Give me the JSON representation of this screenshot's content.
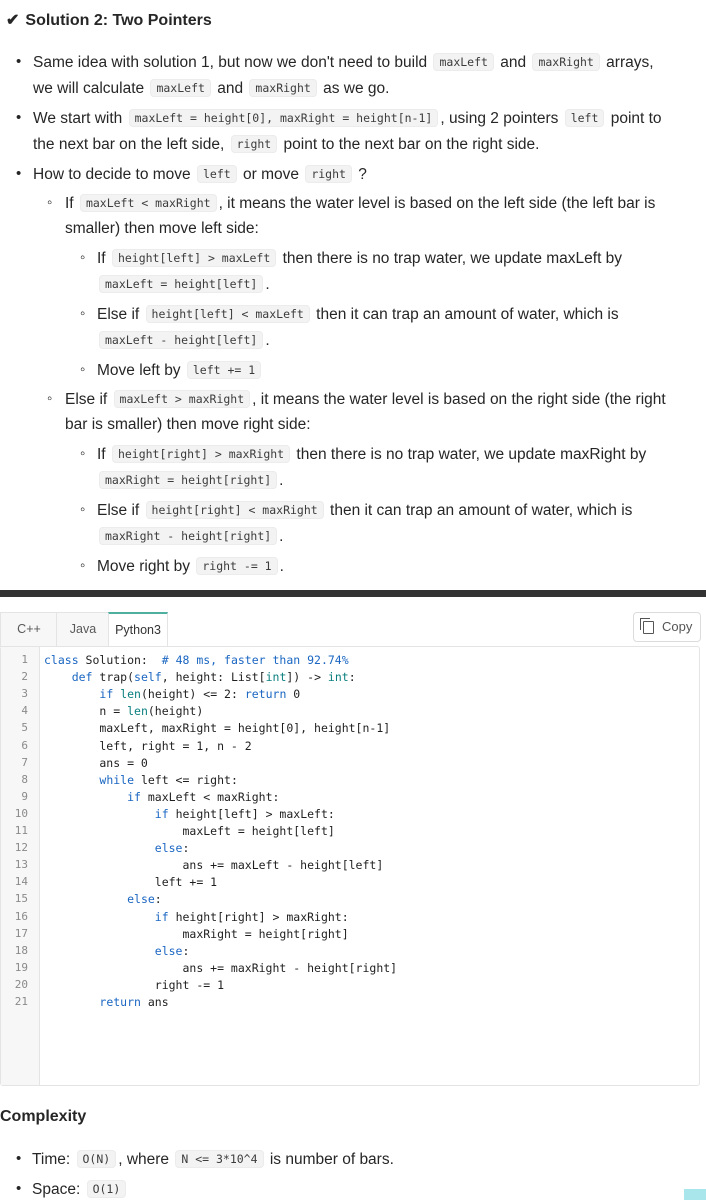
{
  "title": "Solution 2: Two Pointers",
  "content": {
    "b1_l1a": "Same idea with solution 1, but now we don't need to build",
    "b1_code1": "maxLeft",
    "b1_and": "and",
    "b1_code2": "maxRight",
    "b1_arrays": "arrays,",
    "b1_l2a": "we will calculate",
    "b1_code3": "maxLeft",
    "b1_and2": "and",
    "b1_code4": "maxRight",
    "b1_l2b": "as we go.",
    "b2_l1a": "We start with",
    "b2_code1": "maxLeft = height[0], maxRight = height[n-1]",
    "b2_l1b": ", using 2 pointers",
    "b2_code2": "left",
    "b2_l1c": "point to",
    "b2_l2a": "the next bar on the left side,",
    "b2_code3": "right",
    "b2_l2b": "point to the next bar on the right side.",
    "b3_a": "How to decide to move",
    "b3_code1": "left",
    "b3_b": "or move",
    "b3_code2": "right",
    "b3_c": "?",
    "s1_a": "If",
    "s1_code": "maxLeft < maxRight",
    "s1_b": ", it means the water level is based on the left side (the left bar is",
    "s1_l2": "smaller) then move left side:",
    "s1a_a": "If",
    "s1a_code": "height[left] > maxLeft",
    "s1a_b": "then there is no trap water, we update maxLeft by",
    "s1a_code2": "maxLeft = height[left]",
    "s1a_dot": ".",
    "s1b_a": "Else if",
    "s1b_code": "height[left] < maxLeft",
    "s1b_b": "then it can trap an amount of water, which is",
    "s1b_code2": "maxLeft - height[left]",
    "s1b_dot": ".",
    "s1c_a": "Move left by",
    "s1c_code": "left += 1",
    "s2_a": "Else if",
    "s2_code": "maxLeft > maxRight",
    "s2_b": ", it means the water level is based on the right side (the right",
    "s2_l2": "bar is smaller) then move right side:",
    "s2a_a": "If",
    "s2a_code": "height[right] > maxRight",
    "s2a_b": "then there is no trap water, we update maxRight by",
    "s2a_code2": "maxRight = height[right]",
    "s2a_dot": ".",
    "s2b_a": "Else if",
    "s2b_code": "height[right] < maxRight",
    "s2b_b": "then it can trap an amount of water, which is",
    "s2b_code2": "maxRight - height[right]",
    "s2b_dot": ".",
    "s2c_a": "Move right by",
    "s2c_code": "right -= 1",
    "s2c_dot": "."
  },
  "tabs": [
    "C++",
    "Java",
    "Python3"
  ],
  "copy_label": "Copy",
  "code_lines": [
    "class Solution:  # 48 ms, faster than 92.74%",
    "    def trap(self, height: List[int]) -> int:",
    "        if len(height) <= 2: return 0",
    "        n = len(height)",
    "        maxLeft, maxRight = height[0], height[n-1]",
    "        left, right = 1, n - 2",
    "        ans = 0",
    "        while left <= right:",
    "            if maxLeft < maxRight:",
    "                if height[left] > maxLeft:",
    "                    maxLeft = height[left]",
    "                else:",
    "                    ans += maxLeft - height[left]",
    "                left += 1",
    "            else:",
    "                if height[right] > maxRight:",
    "                    maxRight = height[right]",
    "                else:",
    "                    ans += maxRight - height[right]",
    "                right -= 1",
    "        return ans"
  ],
  "complexity": {
    "heading": "Complexity",
    "time_label": "Time:",
    "time_code": "O(N)",
    "time_mid": ", where",
    "time_code2": "N <= 3*10^4",
    "time_end": "is number of bars.",
    "space_label": "Space:",
    "space_code": "O(1)"
  }
}
